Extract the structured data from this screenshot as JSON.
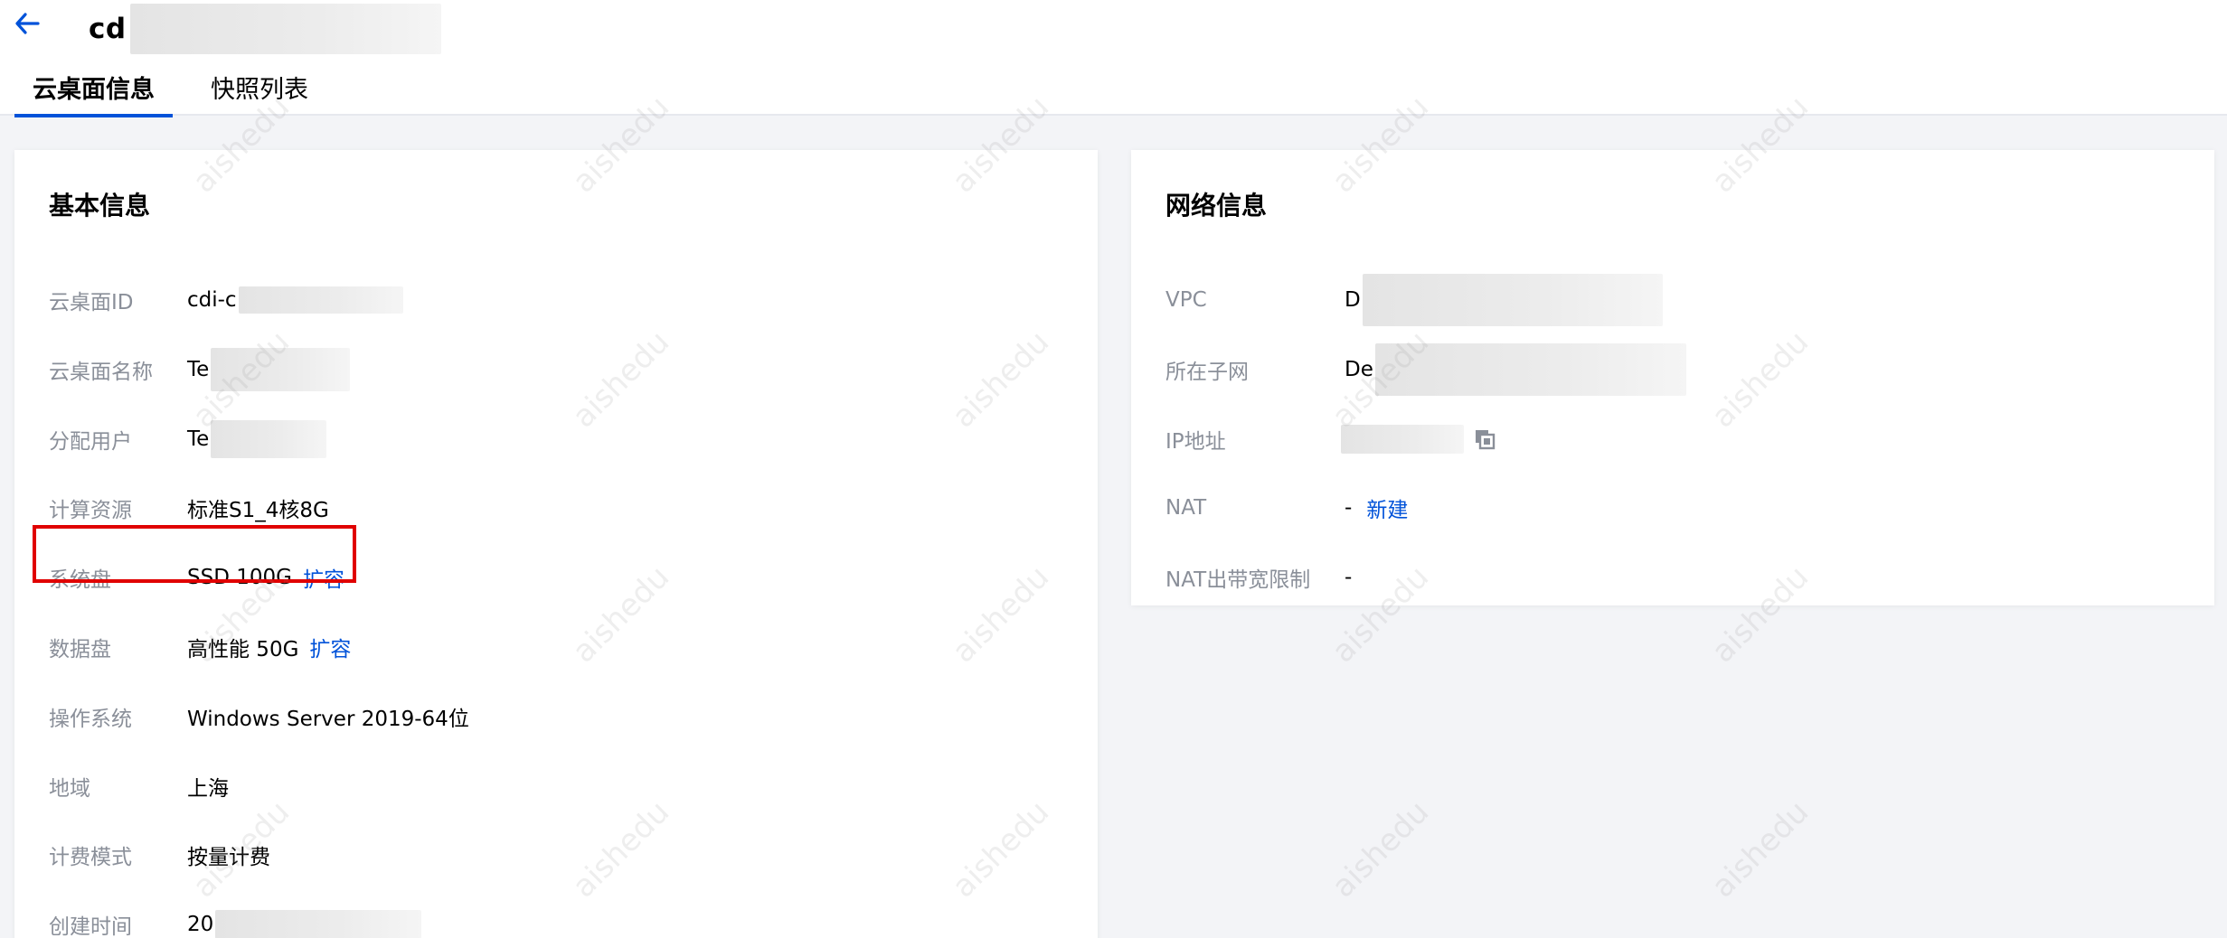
{
  "header": {
    "title_prefix": "cd",
    "back_icon": "arrow-left-icon"
  },
  "tabs": [
    {
      "label": "云桌面信息",
      "active": true
    },
    {
      "label": "快照列表",
      "active": false
    }
  ],
  "basic_info": {
    "title": "基本信息",
    "rows": [
      {
        "label": "云桌面ID",
        "value": "cdi-c"
      },
      {
        "label": "云桌面名称",
        "value": "Te"
      },
      {
        "label": "分配用户",
        "value": "Te"
      },
      {
        "label": "计算资源",
        "value": "标准S1_4核8G"
      },
      {
        "label": "系统盘",
        "value": "SSD 100G",
        "action": "扩容"
      },
      {
        "label": "数据盘",
        "value": "高性能 50G",
        "action": "扩容"
      },
      {
        "label": "操作系统",
        "value": "Windows Server 2019-64位"
      },
      {
        "label": "地域",
        "value": "上海"
      },
      {
        "label": "计费模式",
        "value": "按量计费"
      },
      {
        "label": "创建时间",
        "value": "20"
      }
    ]
  },
  "network_info": {
    "title": "网络信息",
    "rows": [
      {
        "label": "VPC",
        "value": "D"
      },
      {
        "label": "所在子网",
        "value": "De"
      },
      {
        "label": "IP地址",
        "value": ""
      },
      {
        "label": "NAT",
        "value": "-",
        "action": "新建"
      },
      {
        "label": "NAT出带宽限制",
        "value": "-"
      }
    ],
    "copy_icon": "copy-icon"
  },
  "watermark": "aishedu",
  "colors": {
    "accent": "#0052d9",
    "highlight": "#e00000",
    "page_bg": "#f3f4f7"
  }
}
